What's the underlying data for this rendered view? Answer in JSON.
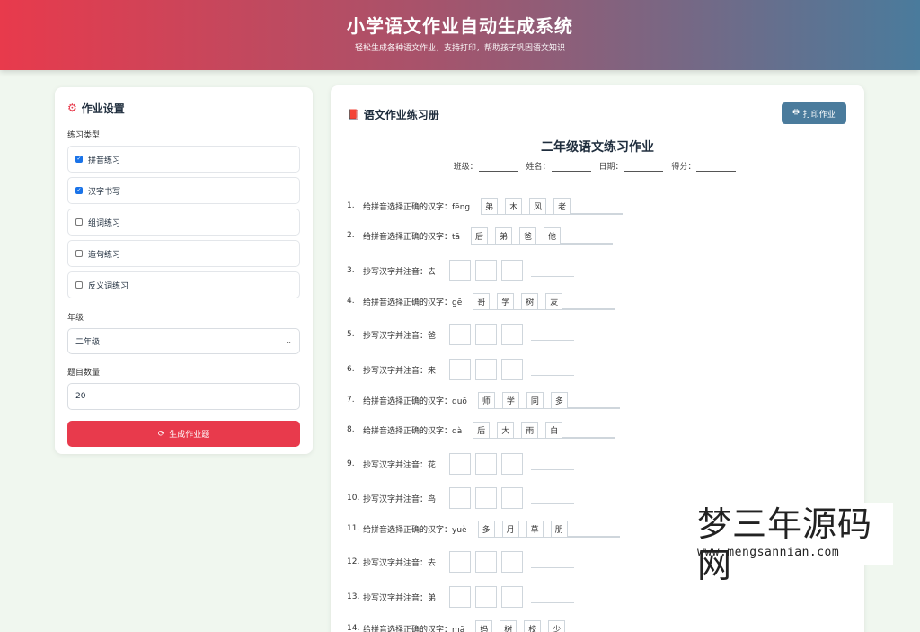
{
  "header": {
    "title": "小学语文作业自动生成系统",
    "subtitle": "轻松生成各种语文作业，支持打印，帮助孩子巩固语文知识"
  },
  "settings": {
    "title": "作业设置",
    "icon": "gears-icon",
    "type_label": "练习类型",
    "types": [
      {
        "label": "拼音练习",
        "checked": true
      },
      {
        "label": "汉字书写",
        "checked": true
      },
      {
        "label": "组词练习",
        "checked": false
      },
      {
        "label": "造句练习",
        "checked": false
      },
      {
        "label": "反义词练习",
        "checked": false
      }
    ],
    "grade_label": "年级",
    "grade_value": "二年级",
    "count_label": "题目数量",
    "count_value": "20",
    "generate_label": "生成作业题",
    "accent": "#e83a4c"
  },
  "worksheet": {
    "title": "语文作业练习册",
    "print_label": "打印作业",
    "sheet_title": "二年级语文练习作业",
    "info": {
      "class": "班级：",
      "name": "姓名：",
      "date": "日期：",
      "score": "得分："
    },
    "questions": [
      {
        "num": "1.",
        "text": "给拼音选择正确的汉字：fēng",
        "choices": [
          "弟",
          "木",
          "风",
          "老"
        ]
      },
      {
        "num": "2.",
        "text": "给拼音选择正确的汉字：tā",
        "choices": [
          "后",
          "弟",
          "爸",
          "他"
        ]
      },
      {
        "num": "3.",
        "text": "抄写汉字并注音：去"
      },
      {
        "num": "4.",
        "text": "给拼音选择正确的汉字：gē",
        "choices": [
          "哥",
          "学",
          "树",
          "友"
        ]
      },
      {
        "num": "5.",
        "text": "抄写汉字并注音：爸"
      },
      {
        "num": "6.",
        "text": "抄写汉字并注音：来"
      },
      {
        "num": "7.",
        "text": "给拼音选择正确的汉字：duō",
        "choices": [
          "师",
          "学",
          "同",
          "多"
        ]
      },
      {
        "num": "8.",
        "text": "给拼音选择正确的汉字：dà",
        "choices": [
          "后",
          "大",
          "雨",
          "白"
        ]
      },
      {
        "num": "9.",
        "text": "抄写汉字并注音：花"
      },
      {
        "num": "10.",
        "text": "抄写汉字并注音：鸟"
      },
      {
        "num": "11.",
        "text": "给拼音选择正确的汉字：yuè",
        "choices": [
          "多",
          "月",
          "草",
          "朋"
        ]
      },
      {
        "num": "12.",
        "text": "抄写汉字并注音：去"
      },
      {
        "num": "13.",
        "text": "抄写汉字并注音：弟"
      },
      {
        "num": "14.",
        "text": "给拼音选择正确的汉字：mā",
        "choices": [
          "妈",
          "树",
          "校",
          "少"
        ]
      }
    ]
  },
  "watermark": {
    "big": "梦三年源码网",
    "small": "www.mengsannian.com"
  }
}
